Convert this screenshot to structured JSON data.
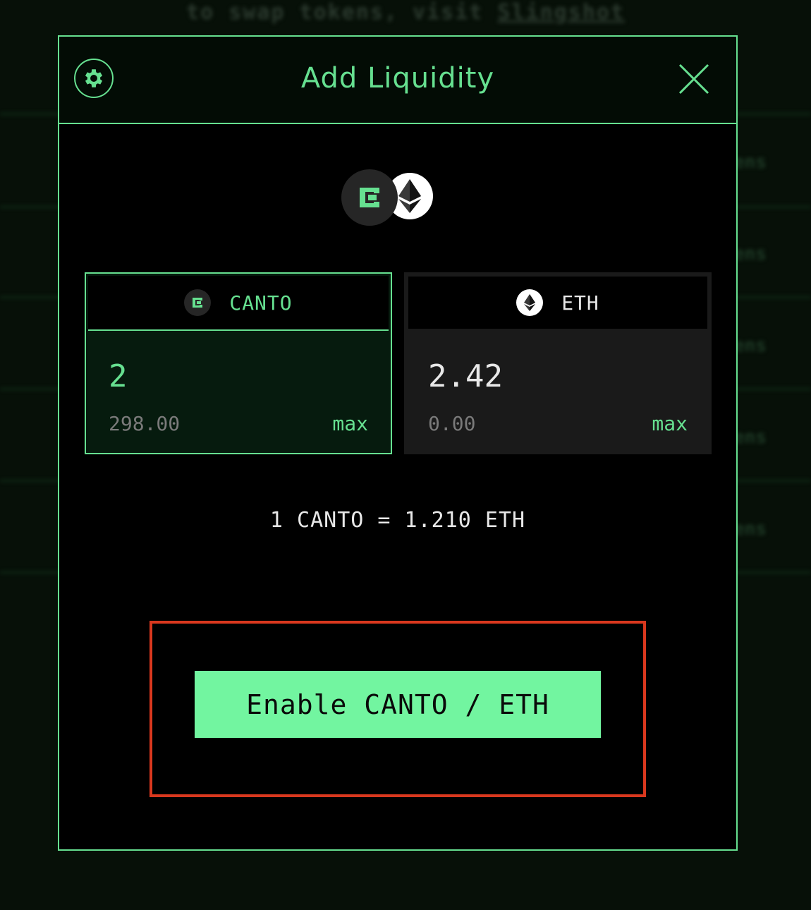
{
  "background": {
    "top_text": "to swap tokens, visit",
    "top_link": "Slingshot",
    "side_fragments": [
      "ens",
      "ens",
      "ens",
      "ens",
      "ens"
    ]
  },
  "modal": {
    "title": "Add Liquidity",
    "settings_icon": "gear-icon",
    "close_icon": "close-icon"
  },
  "tokens": [
    {
      "symbol": "CANTO",
      "amount": "2",
      "balance": "298.00",
      "max_label": "max",
      "icon": "canto-icon"
    },
    {
      "symbol": "ETH",
      "amount": "2.42",
      "balance": "0.00",
      "max_label": "max",
      "icon": "eth-icon"
    }
  ],
  "rate": "1 CANTO = 1.210 ETH",
  "enable_button": {
    "label": "Enable CANTO / ETH"
  },
  "colors": {
    "accent": "#66e090",
    "button": "#72f5a0",
    "highlight": "#d9381e",
    "panel": "#1a1a1a"
  }
}
